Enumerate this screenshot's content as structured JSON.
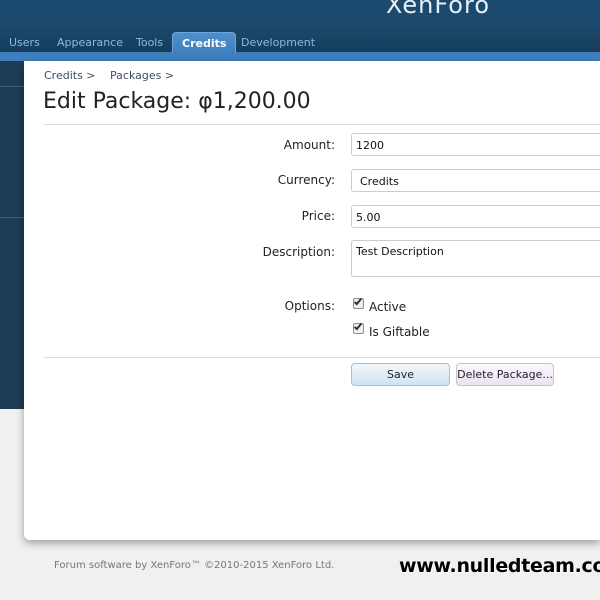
{
  "header": {
    "logo": "XenForo",
    "tabs": [
      {
        "label": "Users"
      },
      {
        "label": "Appearance"
      },
      {
        "label": "Tools"
      },
      {
        "label": "Credits",
        "active": true
      },
      {
        "label": "Development"
      }
    ],
    "accent_color": "#3f7fbd"
  },
  "breadcrumb": [
    "Credits >",
    "Packages >"
  ],
  "page": {
    "title": "Edit Package: φ1,200.00"
  },
  "form": {
    "amount": {
      "label": "Amount:",
      "value": "1200"
    },
    "currency": {
      "label": "Currency:",
      "value": "Credits"
    },
    "price": {
      "label": "Price:",
      "value": "5.00"
    },
    "description": {
      "label": "Description:",
      "value": "Test Description"
    },
    "options": {
      "label": "Options:",
      "active": {
        "label": "Active",
        "checked": true
      },
      "giftable": {
        "label": "Is Giftable",
        "checked": true
      }
    },
    "save_label": "Save",
    "delete_label": "Delete Package..."
  },
  "footer": {
    "text": "Forum software by XenForo™ ©2010-2015 XenForo Ltd."
  },
  "watermark": "www.nulledteam.com"
}
